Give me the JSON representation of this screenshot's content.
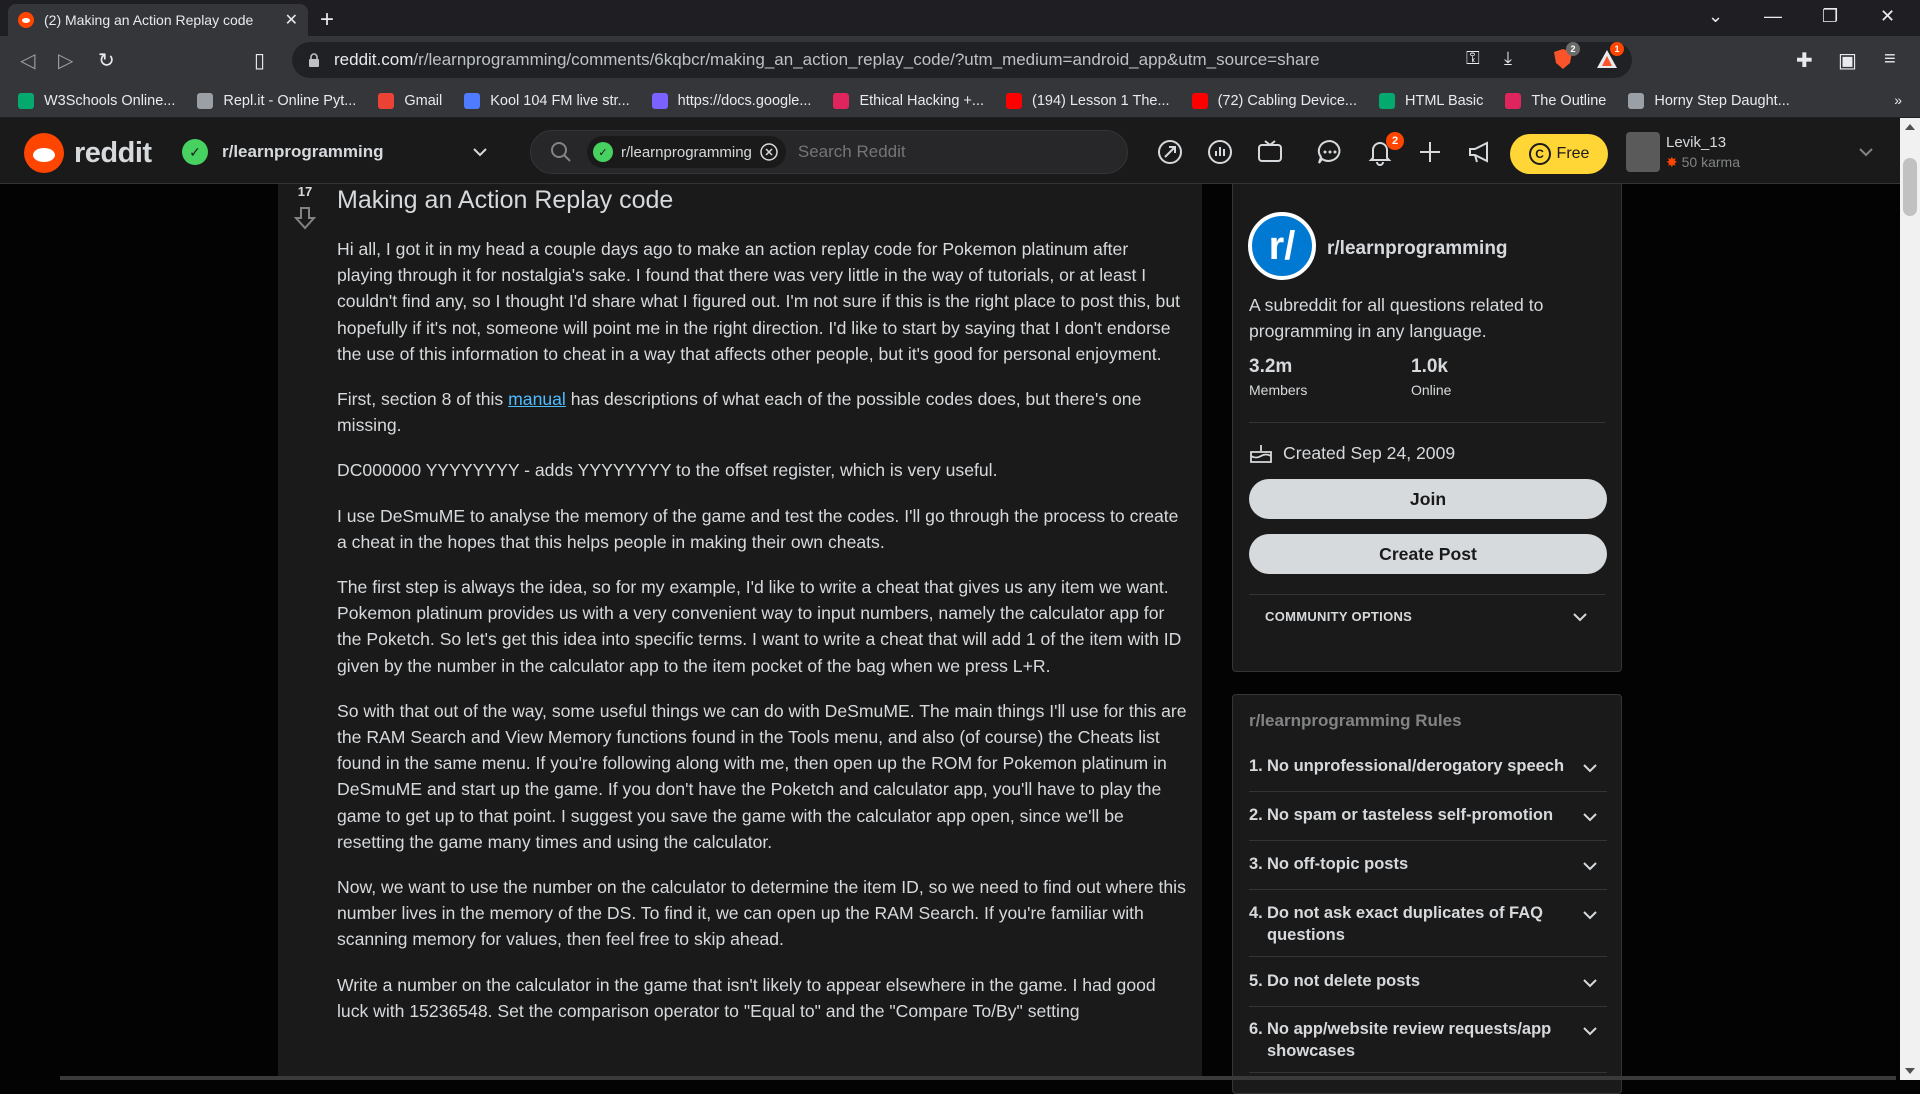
{
  "browser": {
    "tab_title": "(2) Making an Action Replay code",
    "url_domain": "reddit.com",
    "url_path": "/r/learnprogramming/comments/6kqbcr/making_an_action_replay_code/?utm_medium=android_app&utm_source=share",
    "bookmarks": [
      {
        "label": "W3Schools Online...",
        "color": "#04aa6d"
      },
      {
        "label": "Repl.it - Online Pyt...",
        "color": "#9aa0a6"
      },
      {
        "label": "Gmail",
        "color": "#ea4335"
      },
      {
        "label": "Kool 104 FM live str...",
        "color": "#4f7bff"
      },
      {
        "label": "https://docs.google...",
        "color": "#7b61ff"
      },
      {
        "label": "Ethical Hacking +...",
        "color": "#e0245e"
      },
      {
        "label": "(194) Lesson 1 The...",
        "color": "#ff0000"
      },
      {
        "label": "(72) Cabling Device...",
        "color": "#ff0000"
      },
      {
        "label": "HTML Basic",
        "color": "#04aa6d"
      },
      {
        "label": "The Outline",
        "color": "#e0245e"
      },
      {
        "label": "Horny Step Daught...",
        "color": "#9aa0a6"
      }
    ],
    "bookmarks_more": "»",
    "ext_badge_1": "2",
    "ext_badge_2": "1"
  },
  "header": {
    "wordmark": "reddit",
    "community": "r/learnprogramming",
    "search_chip": "r/learnprogramming",
    "search_placeholder": "Search Reddit",
    "notifications_count": "2",
    "free_label": "Free",
    "username": "Levik_13",
    "karma": "50 karma"
  },
  "post": {
    "score": "17",
    "title": "Making an Action Replay code",
    "paragraphs": [
      "Hi all, I got it in my head a couple days ago to make an action replay code for Pokemon platinum after playing through it for nostalgia's sake. I found that there was very little in the way of tutorials, or at least I couldn't find any, so I thought I'd share what I figured out. I'm not sure if this is the right place to post this, but hopefully if it's not, someone will point me in the right direction. I'd like to start by saying that I don't endorse the use of this information to cheat in a way that affects other people, but it's good for personal enjoyment.",
      "DC000000 YYYYYYYY - adds YYYYYYYY to the offset register, which is very useful.",
      "I use DeSmuME to analyse the memory of the game and test the codes. I'll go through the process to create a cheat in the hopes that this helps people in making their own cheats.",
      "The first step is always the idea, so for my example, I'd like to write a cheat that gives us any item we want. Pokemon platinum provides us with a very convenient way to input numbers, namely the calculator app for the Poketch. So let's get this idea into specific terms. I want to write a cheat that will add 1 of the item with ID given by the number in the calculator app to the item pocket of the bag when we press L+R.",
      "So with that out of the way, some useful things we can do with DeSmuME. The main things I'll use for this are the RAM Search and View Memory functions found in the Tools menu, and also (of course) the Cheats list found in the same menu. If you're following along with me, then open up the ROM for Pokemon platinum in DeSmuME and start up the game. If you don't have the Poketch and calculator app, you'll have to play the game to get up to that point. I suggest you save the game with the calculator app open, since we'll be resetting the game many times and using the calculator.",
      "Now, we want to use the number on the calculator to determine the item ID, so we need to find out where this number lives in the memory of the DS. To find it, we can open up the RAM Search. If you're familiar with scanning memory for values, then feel free to skip ahead.",
      "Write a number on the calculator in the game that isn't likely to appear elsewhere in the game. I had good luck with 15236548. Set the comparison operator to \"Equal to\" and the \"Compare To/By\" setting"
    ],
    "p2_before": "First, section 8 of this ",
    "p2_link": "manual",
    "p2_after": " has descriptions of what each of the possible codes does, but there's one missing."
  },
  "sidebar": {
    "name": "r/learnprogramming",
    "avatar_text": "r/",
    "description": "A subreddit for all questions related to programming in any language.",
    "members_count": "3.2m",
    "members_label": "Members",
    "online_count": "1.0k",
    "online_label": "Online",
    "created": "Created Sep 24, 2009",
    "join_label": "Join",
    "create_post_label": "Create Post",
    "community_options": "COMMUNITY OPTIONS",
    "rules_title": "r/learnprogramming Rules",
    "rules": [
      {
        "num": "1.",
        "text": "No unprofessional/derogatory speech"
      },
      {
        "num": "2.",
        "text": "No spam or tasteless self-promotion"
      },
      {
        "num": "3.",
        "text": "No off-topic posts"
      },
      {
        "num": "4.",
        "text": "Do not ask exact duplicates of FAQ questions"
      },
      {
        "num": "5.",
        "text": "Do not delete posts"
      },
      {
        "num": "6.",
        "text": "No app/website review requests/app showcases"
      }
    ]
  },
  "colors": {
    "accent": "#ff4500",
    "link": "#4fbcff",
    "premium": "#ffd635",
    "community": "#46d160"
  }
}
